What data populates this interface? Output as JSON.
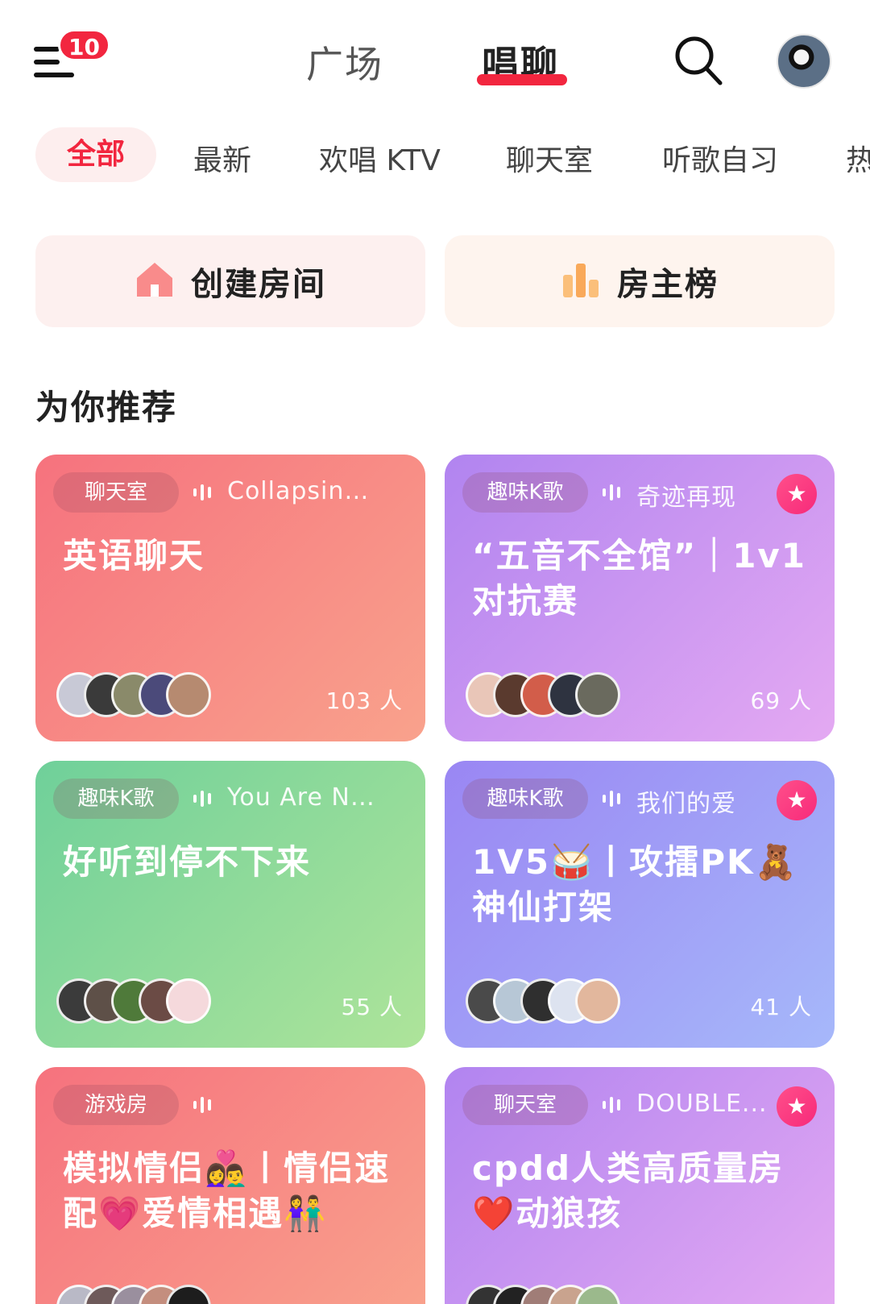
{
  "header": {
    "badge_count": "10",
    "tabs": [
      "广场",
      "唱聊"
    ],
    "active_tab": "唱聊"
  },
  "categories": [
    "全部",
    "最新",
    "欢唱 KTV",
    "聊天室",
    "听歌自习",
    "热"
  ],
  "actions": {
    "create_label": "创建房间",
    "rank_label": "房主榜"
  },
  "section_title": "为你推荐",
  "rooms": [
    {
      "tag": "聊天室",
      "song": "Collapsing...",
      "title": "英语聊天",
      "count": "103 人",
      "star": false
    },
    {
      "tag": "趣味K歌",
      "song": "奇迹再现",
      "title": "“五音不全馆”｜1v1对抗赛",
      "count": "69 人",
      "star": true
    },
    {
      "tag": "趣味K歌",
      "song": "You Are Not...",
      "title": "好听到停不下来",
      "count": "55 人",
      "star": false
    },
    {
      "tag": "趣味K歌",
      "song": "我们的爱",
      "title": "1V5🥁丨攻擂PK🧸神仙打架",
      "count": "41 人",
      "star": true
    },
    {
      "tag": "游戏房",
      "song": "",
      "title": "模拟情侣👩‍❤️‍👨丨情侣速配💗爱情相遇👫",
      "count": "",
      "star": false
    },
    {
      "tag": "聊天室",
      "song": "DOUBLE...",
      "title": "cpdd人类高质量房❤️动狼孩",
      "count": "",
      "star": true
    }
  ],
  "colors": {
    "accent": "#f2263f",
    "card_red": "#f6727e",
    "card_purple": "#b184f0",
    "card_green": "#6fd09a",
    "card_blue": "#9a86f3"
  }
}
